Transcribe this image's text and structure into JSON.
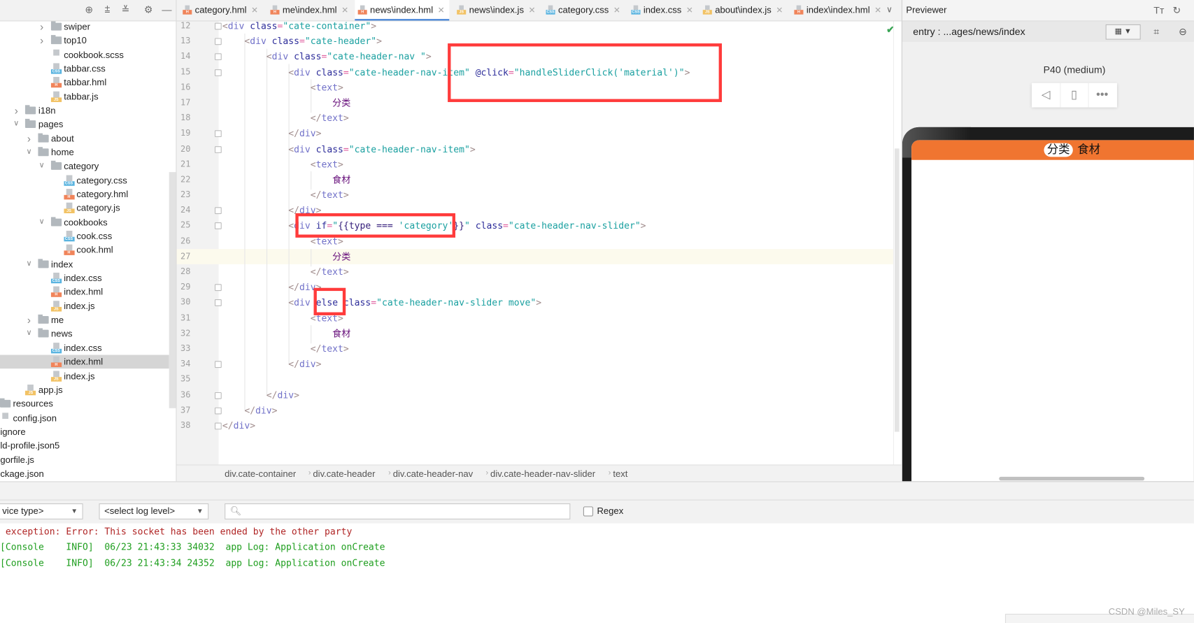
{
  "tree": {
    "items": [
      {
        "label": "swiper",
        "kind": "folder",
        "depth": 4,
        "expanded": false
      },
      {
        "label": "top10",
        "kind": "folder",
        "depth": 4,
        "expanded": false
      },
      {
        "label": "cookbook.scss",
        "kind": "scss",
        "depth": 4
      },
      {
        "label": "tabbar.css",
        "kind": "css",
        "depth": 4
      },
      {
        "label": "tabbar.hml",
        "kind": "hml",
        "depth": 4
      },
      {
        "label": "tabbar.js",
        "kind": "js",
        "depth": 4
      },
      {
        "label": "i18n",
        "kind": "folder",
        "depth": 2,
        "expanded": false
      },
      {
        "label": "pages",
        "kind": "folder",
        "depth": 2,
        "expanded": true
      },
      {
        "label": "about",
        "kind": "folder",
        "depth": 3,
        "expanded": false
      },
      {
        "label": "home",
        "kind": "folder",
        "depth": 3,
        "expanded": true
      },
      {
        "label": "category",
        "kind": "folder",
        "depth": 4,
        "expanded": true
      },
      {
        "label": "category.css",
        "kind": "css",
        "depth": 5
      },
      {
        "label": "category.hml",
        "kind": "hml",
        "depth": 5
      },
      {
        "label": "category.js",
        "kind": "js",
        "depth": 5
      },
      {
        "label": "cookbooks",
        "kind": "folder",
        "depth": 4,
        "expanded": true
      },
      {
        "label": "cook.css",
        "kind": "css",
        "depth": 5
      },
      {
        "label": "cook.hml",
        "kind": "hml",
        "depth": 5
      },
      {
        "label": "index",
        "kind": "folder",
        "depth": 3,
        "expanded": true
      },
      {
        "label": "index.css",
        "kind": "css",
        "depth": 4
      },
      {
        "label": "index.hml",
        "kind": "hml",
        "depth": 4
      },
      {
        "label": "index.js",
        "kind": "js",
        "depth": 4
      },
      {
        "label": "me",
        "kind": "folder",
        "depth": 3,
        "expanded": false
      },
      {
        "label": "news",
        "kind": "folder",
        "depth": 3,
        "expanded": true
      },
      {
        "label": "index.css",
        "kind": "css",
        "depth": 4
      },
      {
        "label": "index.hml",
        "kind": "hml",
        "depth": 4,
        "selected": true
      },
      {
        "label": "index.js",
        "kind": "js",
        "depth": 4
      },
      {
        "label": "app.js",
        "kind": "js",
        "depth": 2
      },
      {
        "label": "resources",
        "kind": "folder",
        "depth": 0
      },
      {
        "label": "config.json",
        "kind": "json",
        "depth": 0
      },
      {
        "label": "ignore",
        "kind": "none",
        "depth": -1
      },
      {
        "label": "ld-profile.json5",
        "kind": "none",
        "depth": -1
      },
      {
        "label": "gorfile.js",
        "kind": "none",
        "depth": -1
      },
      {
        "label": "ckage.json",
        "kind": "none",
        "depth": -1
      }
    ],
    "toolbar_icons": [
      "locate-icon",
      "expand-all-icon",
      "collapse-all-icon",
      "gear-icon",
      "minimize-icon"
    ]
  },
  "tabs": [
    {
      "label": "category.hml",
      "kind": "hml"
    },
    {
      "label": "me\\index.hml",
      "kind": "hml"
    },
    {
      "label": "news\\index.hml",
      "kind": "hml",
      "active": true
    },
    {
      "label": "news\\index.js",
      "kind": "js"
    },
    {
      "label": "category.css",
      "kind": "css"
    },
    {
      "label": "index.css",
      "kind": "css"
    },
    {
      "label": "about\\index.js",
      "kind": "js"
    },
    {
      "label": "index\\index.hml",
      "kind": "hml"
    }
  ],
  "editor": {
    "first_line": 12,
    "current_line": 27,
    "lines": [
      [
        [
          "br",
          "<"
        ],
        [
          "tag",
          "div "
        ],
        [
          "attr",
          "class"
        ],
        [
          "eq",
          "="
        ],
        [
          "str",
          "\"cate-container\""
        ],
        [
          "br",
          ">"
        ]
      ],
      [
        [
          "sp",
          "    "
        ],
        [
          "br",
          "<"
        ],
        [
          "tag",
          "div "
        ],
        [
          "attr",
          "class"
        ],
        [
          "eq",
          "="
        ],
        [
          "str",
          "\"cate-header\""
        ],
        [
          "br",
          ">"
        ]
      ],
      [
        [
          "sp",
          "        "
        ],
        [
          "br",
          "<"
        ],
        [
          "tag",
          "div "
        ],
        [
          "attr",
          "class"
        ],
        [
          "eq",
          "="
        ],
        [
          "str",
          "\"cate-header-nav \""
        ],
        [
          "br",
          ">"
        ]
      ],
      [
        [
          "sp",
          "            "
        ],
        [
          "br",
          "<"
        ],
        [
          "tag",
          "div "
        ],
        [
          "attr",
          "class"
        ],
        [
          "eq",
          "="
        ],
        [
          "str",
          "\"cate-header-nav-item\" "
        ],
        [
          "attr",
          "@click"
        ],
        [
          "eq",
          "="
        ],
        [
          "str",
          "\"handleSliderClick('material')\""
        ],
        [
          "br",
          ">"
        ]
      ],
      [
        [
          "sp",
          "                "
        ],
        [
          "br",
          "<"
        ],
        [
          "tag",
          "text"
        ],
        [
          "br",
          ">"
        ]
      ],
      [
        [
          "sp",
          "                    "
        ],
        [
          "txt",
          "分类"
        ]
      ],
      [
        [
          "sp",
          "                "
        ],
        [
          "br",
          "</"
        ],
        [
          "tag",
          "text"
        ],
        [
          "br",
          ">"
        ]
      ],
      [
        [
          "sp",
          "            "
        ],
        [
          "br",
          "</"
        ],
        [
          "tag",
          "div"
        ],
        [
          "br",
          ">"
        ]
      ],
      [
        [
          "sp",
          "            "
        ],
        [
          "br",
          "<"
        ],
        [
          "tag",
          "div "
        ],
        [
          "attr",
          "class"
        ],
        [
          "eq",
          "="
        ],
        [
          "str",
          "\"cate-header-nav-item\""
        ],
        [
          "br",
          ">"
        ]
      ],
      [
        [
          "sp",
          "                "
        ],
        [
          "br",
          "<"
        ],
        [
          "tag",
          "text"
        ],
        [
          "br",
          ">"
        ]
      ],
      [
        [
          "sp",
          "                    "
        ],
        [
          "txt",
          "食材"
        ]
      ],
      [
        [
          "sp",
          "                "
        ],
        [
          "br",
          "</"
        ],
        [
          "tag",
          "text"
        ],
        [
          "br",
          ">"
        ]
      ],
      [
        [
          "sp",
          "            "
        ],
        [
          "br",
          "</"
        ],
        [
          "tag",
          "div"
        ],
        [
          "br",
          ">"
        ]
      ],
      [
        [
          "sp",
          "            "
        ],
        [
          "br",
          "<"
        ],
        [
          "tag",
          "div "
        ],
        [
          "attr",
          "if"
        ],
        [
          "eq",
          "="
        ],
        [
          "str",
          "\""
        ],
        [
          "code",
          "{{type === "
        ],
        [
          "str",
          "'category'"
        ],
        [
          "code",
          "}}"
        ],
        [
          "str",
          "\" "
        ],
        [
          "attr",
          "class"
        ],
        [
          "eq",
          "="
        ],
        [
          "str",
          "\"cate-header-nav-slider\""
        ],
        [
          "br",
          ">"
        ]
      ],
      [
        [
          "sp",
          "                "
        ],
        [
          "br",
          "<"
        ],
        [
          "tag",
          "text"
        ],
        [
          "br",
          ">"
        ]
      ],
      [
        [
          "sp",
          "                    "
        ],
        [
          "txt",
          "分类"
        ]
      ],
      [
        [
          "sp",
          "                "
        ],
        [
          "br",
          "</"
        ],
        [
          "tag",
          "text"
        ],
        [
          "br",
          ">"
        ]
      ],
      [
        [
          "sp",
          "            "
        ],
        [
          "br",
          "</"
        ],
        [
          "tag",
          "div"
        ],
        [
          "br",
          ">"
        ]
      ],
      [
        [
          "sp",
          "            "
        ],
        [
          "br",
          "<"
        ],
        [
          "tag",
          "div "
        ],
        [
          "attr",
          "else "
        ],
        [
          "attr",
          "class"
        ],
        [
          "eq",
          "="
        ],
        [
          "str",
          "\"cate-header-nav-slider move\""
        ],
        [
          "br",
          ">"
        ]
      ],
      [
        [
          "sp",
          "                "
        ],
        [
          "br",
          "<"
        ],
        [
          "tag",
          "text"
        ],
        [
          "br",
          ">"
        ]
      ],
      [
        [
          "sp",
          "                    "
        ],
        [
          "txt",
          "食材"
        ]
      ],
      [
        [
          "sp",
          "                "
        ],
        [
          "br",
          "</"
        ],
        [
          "tag",
          "text"
        ],
        [
          "br",
          ">"
        ]
      ],
      [
        [
          "sp",
          "            "
        ],
        [
          "br",
          "</"
        ],
        [
          "tag",
          "div"
        ],
        [
          "br",
          ">"
        ]
      ],
      [],
      [
        [
          "sp",
          "        "
        ],
        [
          "br",
          "</"
        ],
        [
          "tag",
          "div"
        ],
        [
          "br",
          ">"
        ]
      ],
      [
        [
          "sp",
          "    "
        ],
        [
          "br",
          "</"
        ],
        [
          "tag",
          "div"
        ],
        [
          "br",
          ">"
        ]
      ],
      [
        [
          "br",
          "</"
        ],
        [
          "tag",
          "div"
        ],
        [
          "br",
          ">"
        ]
      ]
    ],
    "breadcrumb": [
      "div.cate-container",
      "div.cate-header",
      "div.cate-header-nav",
      "div.cate-header-nav-slider",
      "text"
    ],
    "status_icon": "check-icon"
  },
  "previewer": {
    "title": "Previewer",
    "entry": "entry : ...ages/news/index",
    "device": "P40 (medium)",
    "screen_nav": [
      "分类",
      "食材"
    ],
    "header_color": "#f07530"
  },
  "console": {
    "device_type": "vice type>",
    "log_level": "<select log level>",
    "search_placeholder": "",
    "regex_label": "Regex",
    "regex_checked": false,
    "lines": [
      {
        "text": " exception: Error: This socket has been ended by the other party",
        "color": "#b02525"
      },
      {
        "text": "[Console    INFO]  06/23 21:43:33 34032  app Log: Application onCreate",
        "color": "#1e9e1e"
      },
      {
        "text": "[Console    INFO]  06/23 21:43:34 24352  app Log: Application onCreate",
        "color": "#1e9e1e"
      }
    ]
  },
  "watermark": "CSDN @Miles_SY"
}
